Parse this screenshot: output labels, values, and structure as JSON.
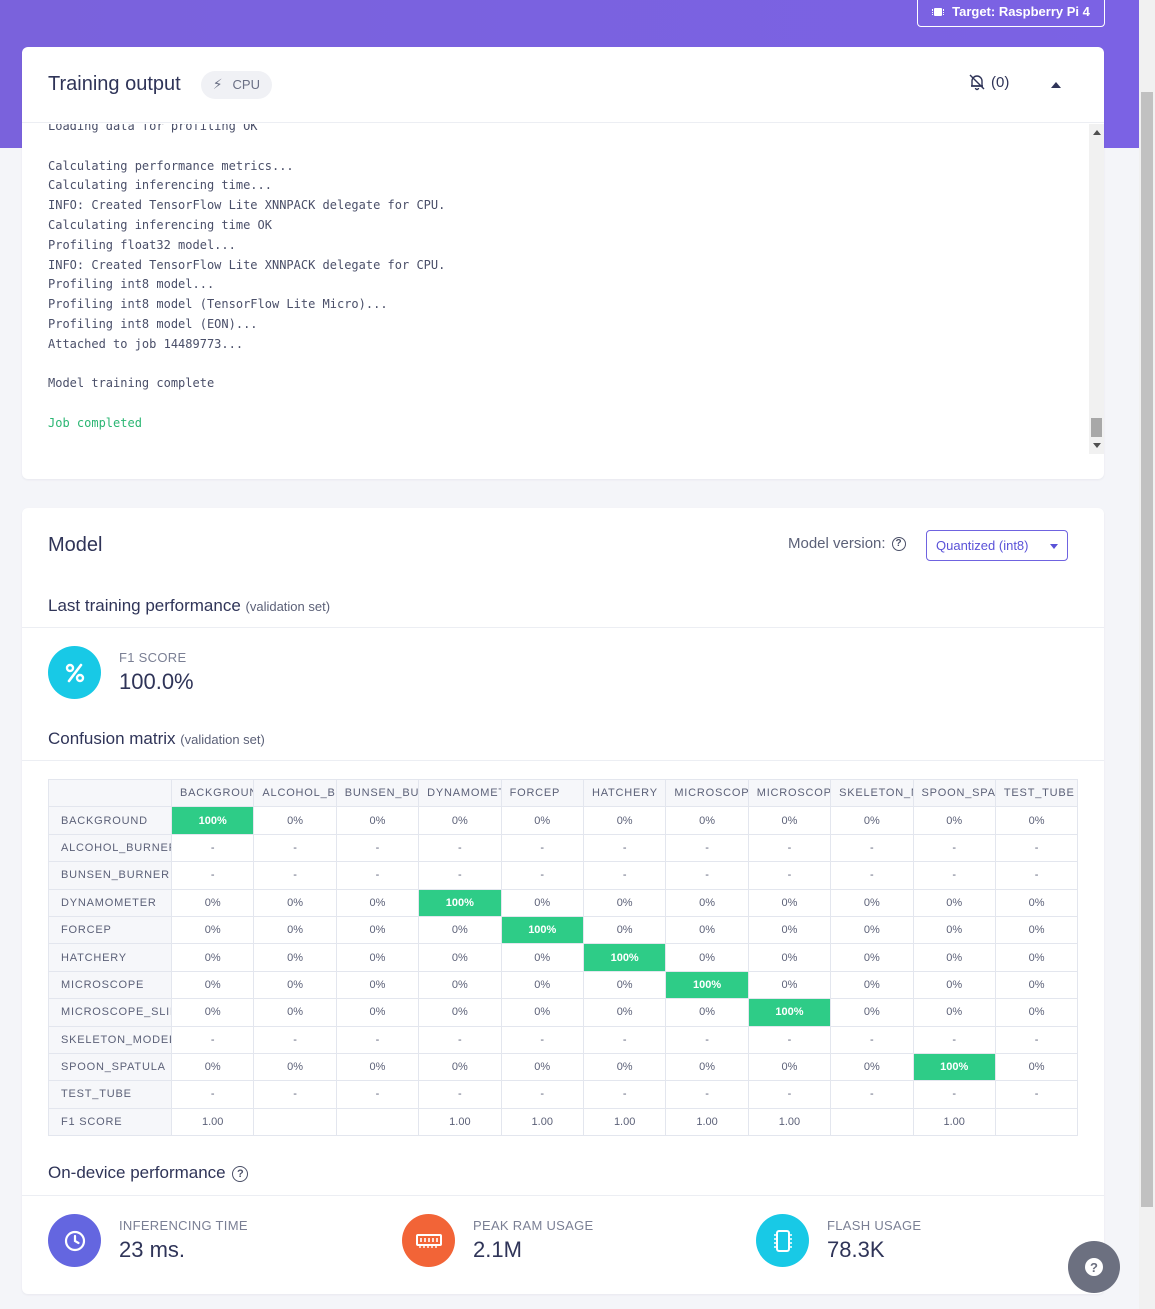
{
  "target": {
    "label": "Target: Raspberry Pi 4"
  },
  "training": {
    "title": "Training output",
    "badge": "CPU",
    "notifications": "(0)",
    "log": [
      "Loading data for profiling OK",
      "",
      "Calculating performance metrics...",
      "Calculating inferencing time...",
      "INFO: Created TensorFlow Lite XNNPACK delegate for CPU.",
      "Calculating inferencing time OK",
      "Profiling float32 model...",
      "INFO: Created TensorFlow Lite XNNPACK delegate for CPU.",
      "Profiling int8 model...",
      "Profiling int8 model (TensorFlow Lite Micro)...",
      "Profiling int8 model (EON)...",
      "Attached to job 14489773...",
      "",
      "Model training complete",
      "",
      "Job completed"
    ]
  },
  "model": {
    "title": "Model",
    "version_label": "Model version:",
    "version_value": "Quantized (int8)",
    "last_perf_title": "Last training performance",
    "last_perf_sub": "(validation set)",
    "f1_label": "F1 SCORE",
    "f1_value": "100.0%",
    "cm_title": "Confusion matrix",
    "cm_sub": "(validation set)",
    "cm_columns": [
      "BACKGROUND",
      "ALCOHOL_BURNER",
      "BUNSEN_BURNER",
      "DYNAMOMETER",
      "FORCEP",
      "HATCHERY",
      "MICROSCOPE",
      "MICROSCOPE_SLIDE",
      "SKELETON_MODEL",
      "SPOON_SPATULA",
      "TEST_TUBE"
    ],
    "cm_rows": [
      {
        "label": "BACKGROUND",
        "cells": [
          "100%",
          "0%",
          "0%",
          "0%",
          "0%",
          "0%",
          "0%",
          "0%",
          "0%",
          "0%",
          "0%"
        ]
      },
      {
        "label": "ALCOHOL_BURNER",
        "cells": [
          "-",
          "-",
          "-",
          "-",
          "-",
          "-",
          "-",
          "-",
          "-",
          "-",
          "-"
        ]
      },
      {
        "label": "BUNSEN_BURNER",
        "cells": [
          "-",
          "-",
          "-",
          "-",
          "-",
          "-",
          "-",
          "-",
          "-",
          "-",
          "-"
        ]
      },
      {
        "label": "DYNAMOMETER",
        "cells": [
          "0%",
          "0%",
          "0%",
          "100%",
          "0%",
          "0%",
          "0%",
          "0%",
          "0%",
          "0%",
          "0%"
        ]
      },
      {
        "label": "FORCEP",
        "cells": [
          "0%",
          "0%",
          "0%",
          "0%",
          "100%",
          "0%",
          "0%",
          "0%",
          "0%",
          "0%",
          "0%"
        ]
      },
      {
        "label": "HATCHERY",
        "cells": [
          "0%",
          "0%",
          "0%",
          "0%",
          "0%",
          "100%",
          "0%",
          "0%",
          "0%",
          "0%",
          "0%"
        ]
      },
      {
        "label": "MICROSCOPE",
        "cells": [
          "0%",
          "0%",
          "0%",
          "0%",
          "0%",
          "0%",
          "100%",
          "0%",
          "0%",
          "0%",
          "0%"
        ]
      },
      {
        "label": "MICROSCOPE_SLIDE",
        "cells": [
          "0%",
          "0%",
          "0%",
          "0%",
          "0%",
          "0%",
          "0%",
          "100%",
          "0%",
          "0%",
          "0%"
        ]
      },
      {
        "label": "SKELETON_MODEL",
        "cells": [
          "-",
          "-",
          "-",
          "-",
          "-",
          "-",
          "-",
          "-",
          "-",
          "-",
          "-"
        ]
      },
      {
        "label": "SPOON_SPATULA",
        "cells": [
          "0%",
          "0%",
          "0%",
          "0%",
          "0%",
          "0%",
          "0%",
          "0%",
          "0%",
          "100%",
          "0%"
        ]
      },
      {
        "label": "TEST_TUBE",
        "cells": [
          "-",
          "-",
          "-",
          "-",
          "-",
          "-",
          "-",
          "-",
          "-",
          "-",
          "-"
        ]
      }
    ],
    "cm_f1_row": {
      "label": "F1 SCORE",
      "cells": [
        "1.00",
        "",
        "",
        "1.00",
        "1.00",
        "1.00",
        "1.00",
        "1.00",
        "",
        "1.00",
        ""
      ]
    },
    "ondevice_title": "On-device performance",
    "inferencing_label": "INFERENCING TIME",
    "inferencing_value": "23 ms.",
    "ram_label": "PEAK RAM USAGE",
    "ram_value": "2.1M",
    "flash_label": "FLASH USAGE",
    "flash_value": "78.3K"
  },
  "colors": {
    "accent": "#7a62dc",
    "hit": "#2ecc87",
    "f1_circle": "#18c9e6",
    "inferencing_circle": "#6466e0",
    "ram_circle": "#f26437",
    "flash_circle": "#18c9e6"
  },
  "icons": {
    "target": "chip-icon",
    "cpu": "bolt-icon",
    "notifications": "bell-off-icon",
    "collapse": "chevron-up-icon",
    "f1": "percent-icon",
    "inferencing": "clock-icon",
    "ram": "memory-icon",
    "flash": "chip-icon",
    "help": "question-icon"
  }
}
